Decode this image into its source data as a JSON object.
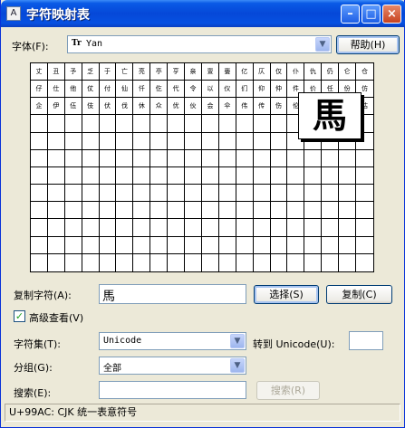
{
  "window": {
    "title": "字符映射表",
    "app_icon": "A",
    "minimize": "–",
    "maximize": "□",
    "close": "×"
  },
  "font_row": {
    "label": "字体(F):",
    "font_icon": "Tr",
    "selected_font": "Yan",
    "help_button": "帮助(H)"
  },
  "char_grid": {
    "rows": 12,
    "columns": 20,
    "chars": [
      "丈",
      "丑",
      "予",
      "乏",
      "于",
      "亡",
      "亮",
      "亭",
      "亨",
      "亲",
      "亶",
      "亹",
      "亿",
      "仄",
      "仅",
      "仆",
      "仇",
      "仍",
      "仑",
      "仓",
      "仔",
      "仕",
      "他",
      "仗",
      "付",
      "仙",
      "仟",
      "仡",
      "代",
      "令",
      "以",
      "仪",
      "们",
      "仰",
      "仲",
      "件",
      "价",
      "任",
      "份",
      "仿",
      "企",
      "伊",
      "伍",
      "伎",
      "伏",
      "伐",
      "休",
      "众",
      "优",
      "伙",
      "会",
      "伞",
      "伟",
      "传",
      "伤",
      "伦",
      "伪",
      "伫",
      "伯",
      "估"
    ],
    "magnified_char": "馬"
  },
  "copy_row": {
    "label": "复制字符(A):",
    "value": "馬",
    "select_button": "选择(S)",
    "copy_button": "复制(C)"
  },
  "advanced_view": {
    "label": "高级查看(V)",
    "checked": true,
    "check_mark": "✓"
  },
  "charset": {
    "label": "字符集(T):",
    "value": "Unicode",
    "goto_label": "转到 Unicode(U):",
    "goto_value": ""
  },
  "group": {
    "label": "分组(G):",
    "value": "全部"
  },
  "search": {
    "label": "搜索(E):",
    "value": "",
    "button": "搜索(R)"
  },
  "status": {
    "text": "U+99AC: CJK 统一表意符号"
  },
  "icons": {
    "dropdown": "▼"
  }
}
